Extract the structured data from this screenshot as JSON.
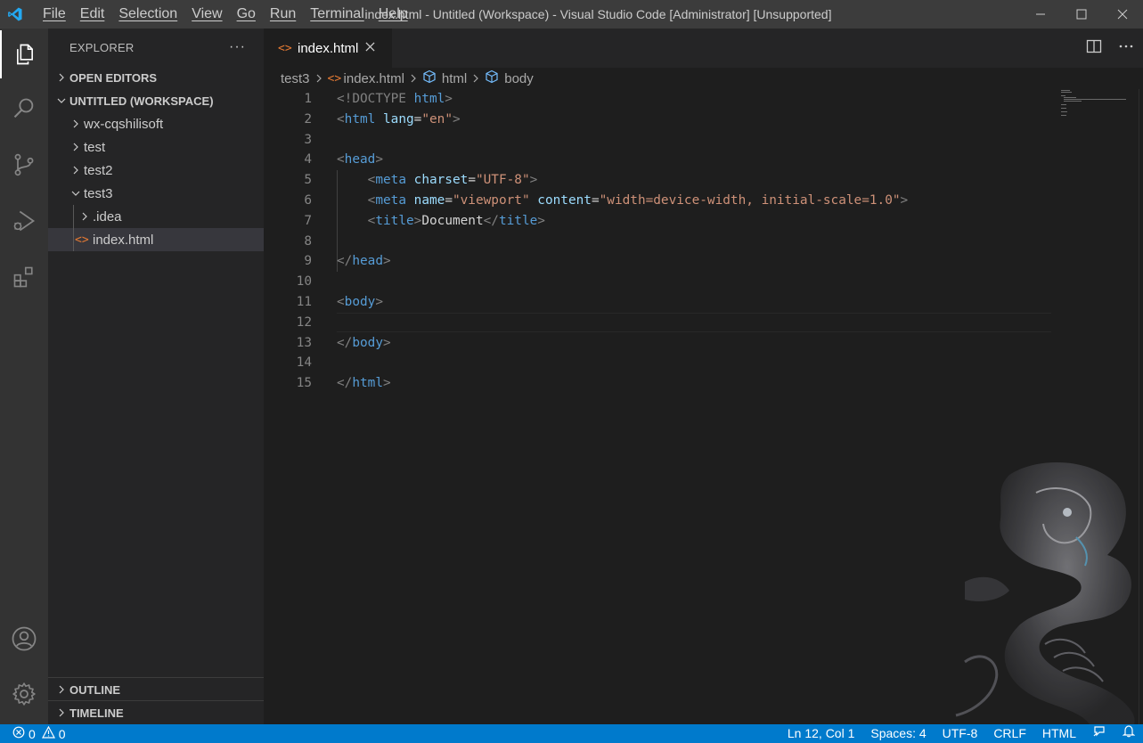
{
  "window": {
    "title": "index.html - Untitled (Workspace) - Visual Studio Code [Administrator] [Unsupported]",
    "menu": [
      "File",
      "Edit",
      "Selection",
      "View",
      "Go",
      "Run",
      "Terminal",
      "Help"
    ]
  },
  "activity_bar": {
    "items": [
      "explorer-icon",
      "search-icon",
      "source-control-icon",
      "run-debug-icon",
      "extensions-icon"
    ],
    "bottom": [
      "accounts-icon",
      "manage-gear-icon"
    ]
  },
  "sidebar": {
    "header": "EXPLORER",
    "more": "···",
    "sections": {
      "open_editors": "OPEN EDITORS",
      "workspace": "UNTITLED (WORKSPACE)",
      "outline": "OUTLINE",
      "timeline": "TIMELINE"
    },
    "tree": {
      "folder1": "wx-cqshilisoft",
      "folder2": "test",
      "folder3": "test2",
      "folder4": "test3",
      "sub_folder": ".idea",
      "file": "index.html"
    }
  },
  "editor": {
    "tab_label": "index.html",
    "tab_icon": "<>",
    "breadcrumbs": {
      "folder": "test3",
      "file": "index.html",
      "sym1": "html",
      "sym2": "body"
    },
    "line_numbers": [
      "1",
      "2",
      "3",
      "4",
      "5",
      "6",
      "7",
      "8",
      "9",
      "10",
      "11",
      "12",
      "13",
      "14",
      "15"
    ],
    "code": {
      "l1_open": "<!DOCTYPE ",
      "l1_name": "html",
      "l1_close": ">",
      "l2_open": "<",
      "l2_tag": "html",
      "l2_attr": "lang",
      "l2_eq": "=",
      "l2_val": "\"en\"",
      "l2_close": ">",
      "l4_tag": "head",
      "l5_tag": "meta",
      "l5_attr": "charset",
      "l5_val": "\"UTF-8\"",
      "l6_tag": "meta",
      "l6_attr1": "name",
      "l6_val1": "\"viewport\"",
      "l6_attr2": "content",
      "l6_val2": "\"width=device-width, initial-scale=1.0\"",
      "l7_tag": "title",
      "l7_text": "Document",
      "l7_ctag": "title",
      "l9_tag": "head",
      "l11_tag": "body",
      "l13_tag": "body",
      "l15_tag": "html"
    }
  },
  "status_bar": {
    "errors": "0",
    "warnings": "0",
    "position": "Ln 12, Col 1",
    "spaces": "Spaces: 4",
    "encoding": "UTF-8",
    "eol": "CRLF",
    "language": "HTML"
  },
  "colors": {
    "accent": "#007acc",
    "title_bar": "#3c3c3c",
    "activity_bar": "#333333",
    "sidebar": "#252526",
    "editor": "#1e1e1e",
    "html_icon": "#e37933"
  }
}
